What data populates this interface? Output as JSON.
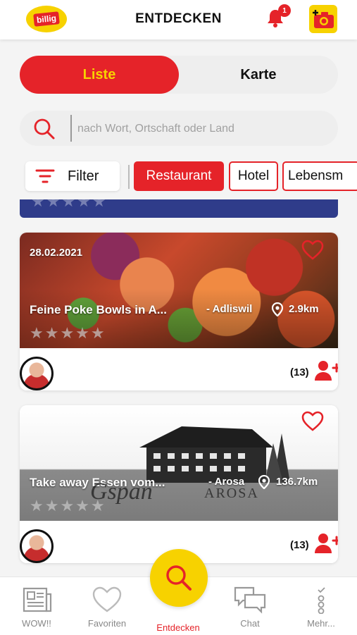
{
  "header": {
    "logo_text": "billig",
    "title": "ENTDECKEN",
    "notification_count": "1"
  },
  "view_toggle": {
    "list_label": "Liste",
    "map_label": "Karte",
    "active": "list"
  },
  "search": {
    "placeholder": "nach Wort, Ortschaft oder Land",
    "value": ""
  },
  "filters": {
    "filter_label": "Filter",
    "categories": [
      "Restaurant",
      "Hotel",
      "Lebensm"
    ],
    "selected": "Restaurant"
  },
  "cards": [
    {
      "date": "28.02.2021",
      "title": "Feine Poke Bowls in A...",
      "location": "- Adliswil",
      "distance": "2.9km",
      "rating_stars": 0,
      "followers": "(13)"
    },
    {
      "date": "",
      "title": "Take away Essen vom...",
      "location": "- Arosa",
      "distance": "136.7km",
      "logo_text_1": "Gspan",
      "logo_text_2": "AROSA",
      "rating_stars": 0,
      "followers": "(13)"
    }
  ],
  "bottom_nav": {
    "items": [
      "WOW!!",
      "Favoriten",
      "Entdecken",
      "Chat",
      "Mehr..."
    ],
    "active": "Entdecken"
  },
  "colors": {
    "brand_red": "#e52329",
    "brand_yellow": "#f7d200",
    "background": "#f4f4f4"
  }
}
